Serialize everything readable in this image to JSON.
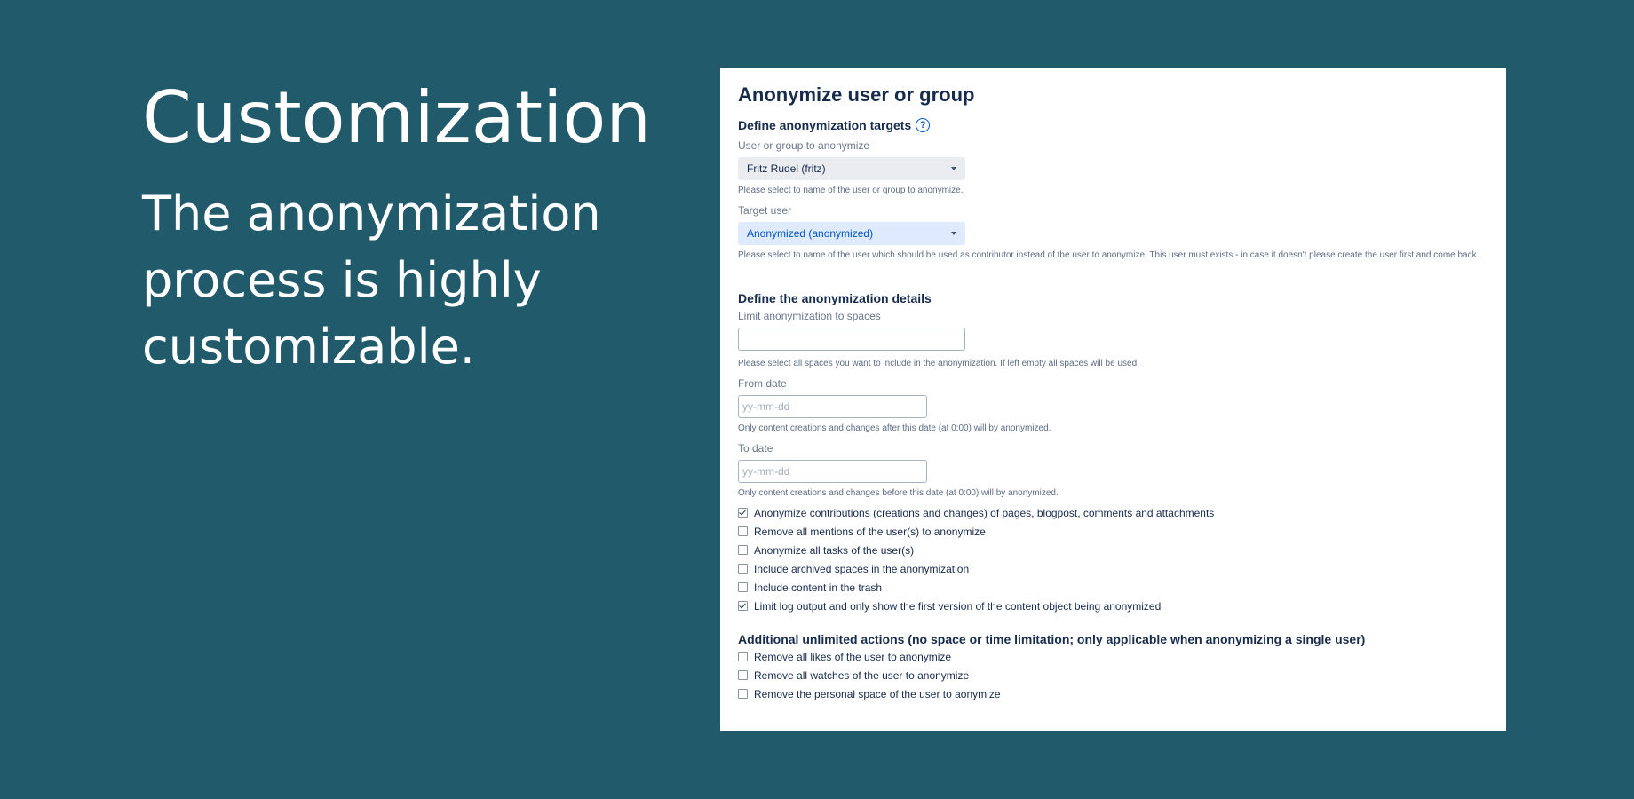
{
  "slide": {
    "title": "Customization",
    "subtitle": "The anonymization process is highly customizable."
  },
  "form": {
    "heading": "Anonymize user or group",
    "targets_section": {
      "heading": "Define anonymization targets",
      "help_icon": "question-circle-icon",
      "user_or_group": {
        "label": "User or group to anonymize",
        "value": "Fritz Rudel (fritz)",
        "help": "Please select to name of the user or group to anonymize."
      },
      "target_user": {
        "label": "Target user",
        "value": "Anonymized (anonymized)",
        "help": "Please select to name of the user which should be used as contributor instead of the user to anonymize. This user must exists - in case it doesn't please create the user first and come back."
      }
    },
    "details_section": {
      "heading": "Define the anonymization details",
      "spaces": {
        "label": "Limit anonymization to spaces",
        "value": "",
        "help": "Please select all spaces you want to include in the anonymization. If left empty all spaces will be used."
      },
      "from_date": {
        "label": "From date",
        "placeholder": "yy-mm-dd",
        "help": "Only content creations and changes after this date (at 0:00) will by anonymized."
      },
      "to_date": {
        "label": "To date",
        "placeholder": "yy-mm-dd",
        "help": "Only content creations and changes before this date (at 0:00) will by anonymized."
      },
      "options": [
        {
          "label": "Anonymize contributions (creations and changes) of pages, blogpost, comments and attachments",
          "checked": true
        },
        {
          "label": "Remove all mentions of the user(s) to anonymize",
          "checked": false
        },
        {
          "label": "Anonymize all tasks of the user(s)",
          "checked": false
        },
        {
          "label": "Include archived spaces in the anonymization",
          "checked": false
        },
        {
          "label": "Include content in the trash",
          "checked": false
        },
        {
          "label": "Limit log output and only show the first version of the content object being anonymized",
          "checked": true
        }
      ]
    },
    "additional_section": {
      "heading": "Additional unlimited actions (no space or time limitation; only applicable when anonymizing a single user)",
      "options": [
        {
          "label": "Remove all likes of the user to anonymize",
          "checked": false
        },
        {
          "label": "Remove all watches of the user to anonymize",
          "checked": false
        },
        {
          "label": "Remove the personal space of the user to aonymize",
          "checked": false
        }
      ]
    }
  },
  "colors": {
    "background": "#215b6b",
    "panel": "#ffffff",
    "text": "#172b4d",
    "link_blue": "#0052cc",
    "selected_blue_bg": "#deebff"
  }
}
